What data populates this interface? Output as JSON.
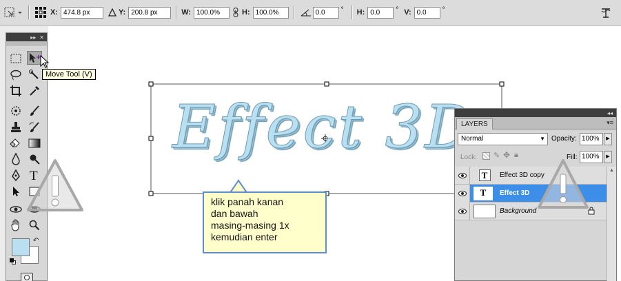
{
  "options_bar": {
    "x_label": "X:",
    "x_value": "474.8 px",
    "y_label": "Y:",
    "y_value": "200.8 px",
    "w_label": "W:",
    "w_value": "100.0%",
    "h_label": "H:",
    "h_value": "100.0%",
    "rotate_value": "0.0",
    "hskew_label": "H:",
    "hskew_value": "0.0",
    "vskew_label": "V:",
    "vskew_value": "0.0",
    "degree_symbol": "°"
  },
  "canvas": {
    "text_art": "Effect 3D"
  },
  "tooltip": {
    "text": "Move Tool (V)"
  },
  "layers_panel": {
    "tab": "LAYERS",
    "blend_mode": "Normal",
    "opacity_label": "Opacity:",
    "opacity_value": "100%",
    "lock_label": "Lock:",
    "fill_label": "Fill:",
    "fill_value": "100%",
    "layers": [
      {
        "name": "Effect 3D copy",
        "type": "text",
        "selected": false
      },
      {
        "name": "Effect 3D",
        "type": "text",
        "selected": true
      },
      {
        "name": "Background",
        "type": "image",
        "selected": false
      }
    ]
  },
  "callout": {
    "line1": "klik panah kanan",
    "line2": "dan bawah",
    "line3": "masing-masing 1x",
    "line4": "kemudian enter"
  },
  "colors": {
    "foreground": "#b9dff0",
    "background": "#ffffff",
    "selection": "#3d8ee8",
    "callout_border": "#5c8ed0"
  }
}
